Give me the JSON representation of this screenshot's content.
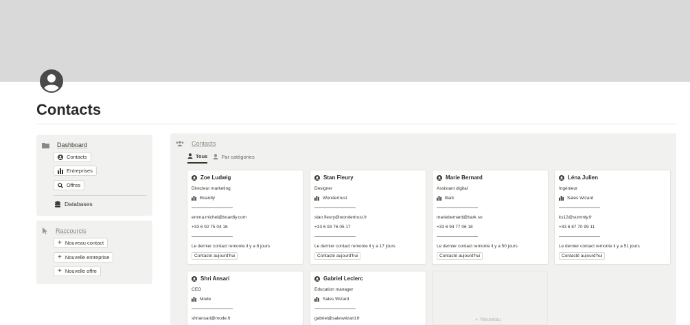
{
  "page": {
    "title": "Contacts"
  },
  "dashboard": {
    "title": "Dashboard",
    "items": [
      {
        "label": "Contacts",
        "icon": "user-circle-icon"
      },
      {
        "label": "Entreprises",
        "icon": "building-icon"
      },
      {
        "label": "Offres",
        "icon": "search-icon"
      }
    ],
    "databases_label": "Databases"
  },
  "shortcuts": {
    "title": "Raccourcis",
    "items": [
      {
        "label": "Nouveau contact"
      },
      {
        "label": "Nouvelle entreprise"
      },
      {
        "label": "Nouvelle offre"
      }
    ]
  },
  "view": {
    "title": "Contacts",
    "tabs": [
      {
        "label": "Tous",
        "active": true
      },
      {
        "label": "Par catégories",
        "active": false
      }
    ],
    "new_label": "Nouveau"
  },
  "contacts": [
    {
      "name": "Zoe Ludwig",
      "role": "Directeur marketing",
      "company": "Boardly",
      "email": "emma.michel@boardly.com",
      "phone": "+33 6 92 75 04 16",
      "last_contact": "Le dernier contact remonte il y a 8 jours",
      "tag": "Contacté aujourd'hui"
    },
    {
      "name": "Stan Fleury",
      "role": "Designer",
      "company": "Wondertrust",
      "email": "stan.fleury@wondertrust.fr",
      "phone": "+33 6 93 76 05 17",
      "last_contact": "Le dernier contact remonte il y a 17 jours",
      "tag": "Contacté aujourd'hui"
    },
    {
      "name": "Marie Bernard",
      "role": "Assistant digital",
      "company": "Bark",
      "email": "mariebernard@bark.so",
      "phone": "+33 6 94 77 06 18",
      "last_contact": "Le dernier contact remonte il y a 50 jours",
      "tag": "Contacté aujourd'hui"
    },
    {
      "name": "Léna Julien",
      "role": "Ingénieur",
      "company": "Sales Wizard",
      "email": "ks12@summly.fr",
      "phone": "+33 6 87 70 99 11",
      "last_contact": "Le dernier contact remonte il y a 51 jours",
      "tag": "Contacté aujourd'hui"
    },
    {
      "name": "Shri Ansari",
      "role": "CEO",
      "company": "Mode",
      "email": "shriansari@mode.fr"
    },
    {
      "name": "Gabriel Leclerc",
      "role": "Education manager",
      "company": "Sales Wizard",
      "email": "gabriel@saleswizard.fr"
    }
  ],
  "colors": {
    "cover": "#d9d9d9",
    "panel": "#f1f1ef",
    "text": "#37352f"
  }
}
